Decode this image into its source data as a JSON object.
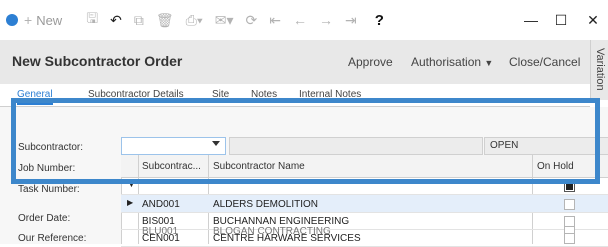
{
  "toolbar": {
    "new_label": "New",
    "help_label": "?",
    "minimize": "—",
    "maximize": "☐",
    "close": "✕"
  },
  "header": {
    "title": "New Subcontractor Order",
    "approve": "Approve",
    "authorisation": "Authorisation",
    "close_cancel": "Close/Cancel",
    "variation": "Variation"
  },
  "tabs": [
    "General",
    "Subcontractor Details",
    "Site",
    "Notes",
    "Internal Notes"
  ],
  "form": {
    "labels": {
      "subcontractor": "Subcontractor:",
      "job_number": "Job Number:",
      "task_number": "Task Number:",
      "order_date": "Order Date:",
      "our_reference": "Our Reference:"
    },
    "subcontractor_value": "",
    "name_value": "",
    "open_label": "OPEN"
  },
  "grid": {
    "columns": [
      "Subcontrac...",
      "Subcontractor Name",
      "On Hold"
    ],
    "filter_icon": "filter-icon",
    "rows": [
      {
        "code": "AND001",
        "name": "ALDERS DEMOLITION"
      },
      {
        "code": "BIS001",
        "name": "BUCHANNAN ENGINEERING"
      },
      {
        "code": "BLU001",
        "name": "BLOGAN CONTRACTING"
      },
      {
        "code": "CEN001",
        "name": "CENTRE HARWARE SERVICES"
      }
    ]
  },
  "colors": {
    "accent": "#2d7fd3",
    "highlight_border": "#3d87cb"
  }
}
